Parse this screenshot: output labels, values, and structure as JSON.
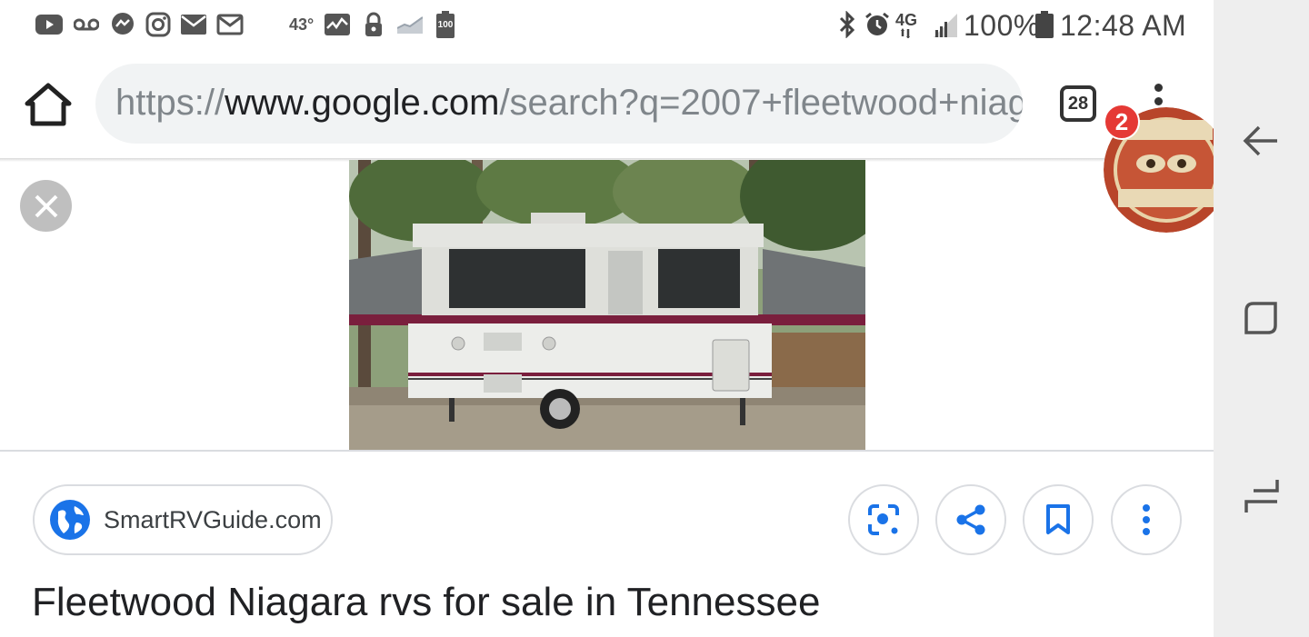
{
  "status_bar": {
    "temperature": "43°",
    "battery_notice": "100",
    "network": "4G",
    "battery": "100%",
    "time": "12:48 AM",
    "icons": [
      "youtube-icon",
      "voicemail-icon",
      "messenger-icon",
      "instagram-icon",
      "mail-icon",
      "mail-outline-icon",
      "weather-icon",
      "activity-icon",
      "lock-icon",
      "signal-strength-icon",
      "battery-full-icon",
      "bluetooth-icon",
      "alarm-icon",
      "network-icon",
      "signal-icon",
      "battery-icon"
    ]
  },
  "browser": {
    "url_scheme": "https://",
    "url_host": "www.google.com",
    "url_path": "/search?q=2007+fleetwood+niag",
    "tab_count": "28"
  },
  "chat_head": {
    "badge_count": "2"
  },
  "result": {
    "source": "SmartRVGuide.com",
    "title": "Fleetwood Niagara rvs for sale in Tennessee",
    "actions": [
      "lens-icon",
      "share-icon",
      "bookmark-icon",
      "more-vert-icon"
    ]
  },
  "colors": {
    "accent_blue": "#1a73e8",
    "badge_red": "#e53935",
    "camper_stripe": "#7a1f3d"
  }
}
